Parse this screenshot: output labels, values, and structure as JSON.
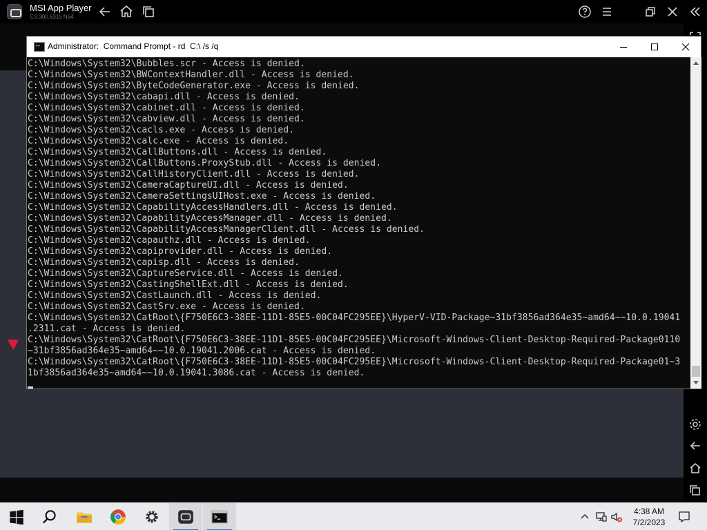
{
  "player": {
    "title": "MSI App Player",
    "version": "5.9.300.6315  N64"
  },
  "cmd_window": {
    "title": "Administrator:  Command Prompt - rd  C:\\ /s /q",
    "minimize_label": "Minimize",
    "maximize_label": "Maximize",
    "close_label": "Close"
  },
  "console": {
    "lines": [
      "C:\\Windows\\System32\\Bubbles.scr - Access is denied.",
      "C:\\Windows\\System32\\BWContextHandler.dll - Access is denied.",
      "C:\\Windows\\System32\\ByteCodeGenerator.exe - Access is denied.",
      "C:\\Windows\\System32\\cabapi.dll - Access is denied.",
      "C:\\Windows\\System32\\cabinet.dll - Access is denied.",
      "C:\\Windows\\System32\\cabview.dll - Access is denied.",
      "C:\\Windows\\System32\\cacls.exe - Access is denied.",
      "C:\\Windows\\System32\\calc.exe - Access is denied.",
      "C:\\Windows\\System32\\CallButtons.dll - Access is denied.",
      "C:\\Windows\\System32\\CallButtons.ProxyStub.dll - Access is denied.",
      "C:\\Windows\\System32\\CallHistoryClient.dll - Access is denied.",
      "C:\\Windows\\System32\\CameraCaptureUI.dll - Access is denied.",
      "C:\\Windows\\System32\\CameraSettingsUIHost.exe - Access is denied.",
      "C:\\Windows\\System32\\CapabilityAccessHandlers.dll - Access is denied.",
      "C:\\Windows\\System32\\CapabilityAccessManager.dll - Access is denied.",
      "C:\\Windows\\System32\\CapabilityAccessManagerClient.dll - Access is denied.",
      "C:\\Windows\\System32\\capauthz.dll - Access is denied.",
      "C:\\Windows\\System32\\capiprovider.dll - Access is denied.",
      "C:\\Windows\\System32\\capisp.dll - Access is denied.",
      "C:\\Windows\\System32\\CaptureService.dll - Access is denied.",
      "C:\\Windows\\System32\\CastingShellExt.dll - Access is denied.",
      "C:\\Windows\\System32\\CastLaunch.dll - Access is denied.",
      "C:\\Windows\\System32\\CastSrv.exe - Access is denied.",
      "C:\\Windows\\System32\\CatRoot\\{F750E6C3-38EE-11D1-85E5-00C04FC295EE}\\HyperV-VID-Package~31bf3856ad364e35~amd64~~10.0.19041",
      ".2311.cat - Access is denied.",
      "C:\\Windows\\System32\\CatRoot\\{F750E6C3-38EE-11D1-85E5-00C04FC295EE}\\Microsoft-Windows-Client-Desktop-Required-Package0110",
      "~31bf3856ad364e35~amd64~~10.0.19041.2006.cat - Access is denied.",
      "C:\\Windows\\System32\\CatRoot\\{F750E6C3-38EE-11D1-85E5-00C04FC295EE}\\Microsoft-Windows-Client-Desktop-Required-Package01~3",
      "1bf3856ad364e35~amd64~~10.0.19041.3086.cat - Access is denied."
    ]
  },
  "taskbar": {
    "items": [
      "start-icon",
      "search-icon",
      "file-explorer-icon",
      "chrome-icon",
      "settings-icon",
      "msi-app-player-icon",
      "command-prompt-icon"
    ]
  },
  "clock": {
    "time": "4:38 AM",
    "date": "7/2/2023"
  },
  "colors": {
    "console_bg": "#0c0c0c",
    "console_text": "#cccccc",
    "player_bar": "#000000",
    "taskbar": "#e8eaed"
  }
}
